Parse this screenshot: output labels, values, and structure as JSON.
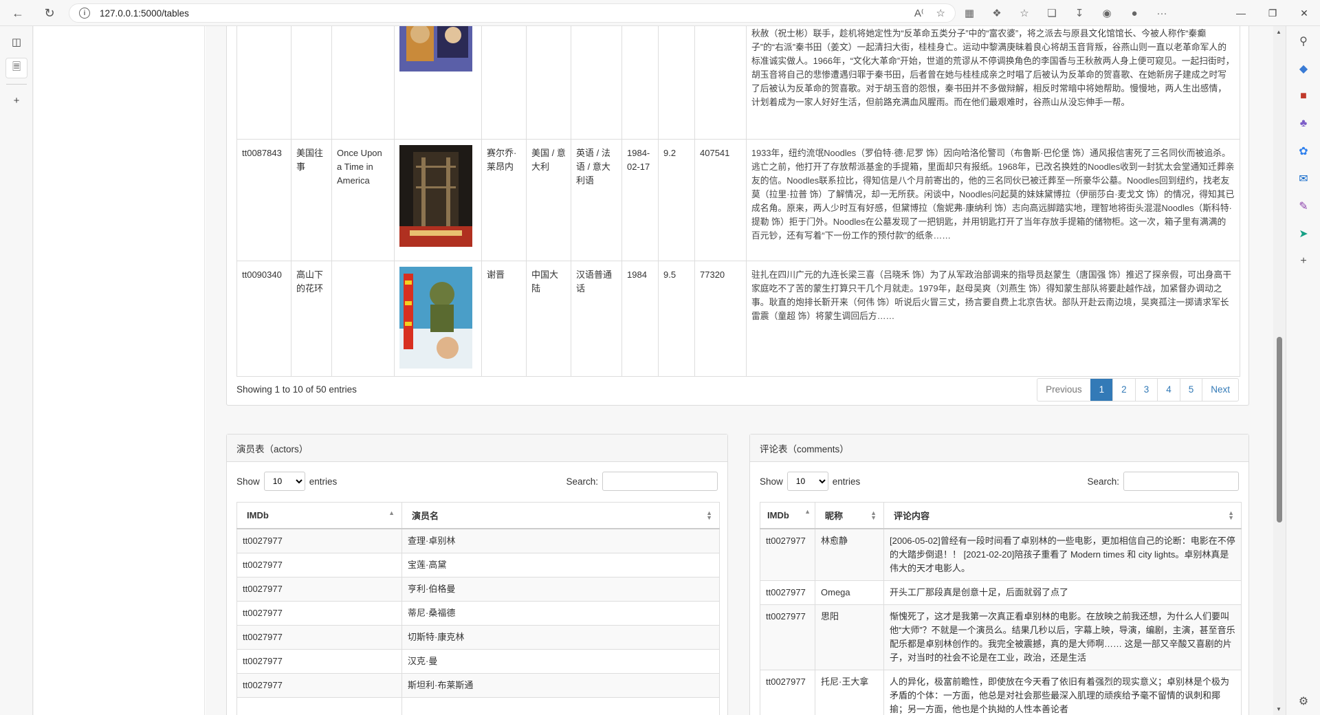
{
  "browser": {
    "url": "127.0.0.1:5000/tables"
  },
  "movies": {
    "rows": [
      {
        "id": "",
        "title": "",
        "title_en": "",
        "director": "",
        "country": "",
        "language": "",
        "date": "",
        "rating": "",
        "votes": "",
        "summary": "备日子更上一层楼时，迎上“四清运动”，一直嫉妒胡玉音的原国营饮食店经理、今县商业局科长李国香（徐松子）与二流子王秋赦（祝士彬）联手，趁机将她定性为“反革命五类分子”中的“富农婆”，将之派去与原县文化馆馆长、今被人称作“秦癫子”的“右派”秦书田（姜文）一起清扫大街，桂桂身亡。运动中黎满庚昧着良心将胡玉音背叛，谷燕山则一直以老革命军人的标准诚实做人。1966年，“文化大革命”开始，世道的荒谬从不停调换角色的李国香与王秋赦两人身上便可窥见。一起扫街时，胡玉音将自己的悲惨遭遇归罪于秦书田，后者曾在她与桂桂成亲之时唱了后被认为反革命的贺喜歌、在她新房子建成之时写了后被认为反革命的贺喜歌。对于胡玉音的怨恨，秦书田并不多做辩解，相反时常暗中将她帮助。慢慢地，两人生出感情，计划着成为一家人好好生活，但前路充满血风腥雨。而在他们最艰难时，谷燕山从没忘伸手一帮。"
      },
      {
        "id": "tt0087843",
        "title": "美国往事",
        "title_en": "Once Upon a Time in America",
        "director": "赛尔乔·莱昂内",
        "country": "美国 / 意大利",
        "language": "英语 / 法语 / 意大利语",
        "date": "1984-02-17",
        "rating": "9.2",
        "votes": "407541",
        "summary": "1933年，纽约流氓Noodles（罗伯特·德·尼罗 饰）因向哈洛伦警司（布鲁斯·巴伦堡 饰）通风报信害死了三名同伙而被追杀。逃亡之前，他打开了存放帮派基金的手提箱，里面却只有报纸。1968年，已改名换姓的Noodles收到一封犹太会堂通知迁葬亲友的信。Noodles联系拉比，得知信是八个月前寄出的，他的三名同伙已被迁葬至一所豪华公墓。Noodles回到纽约，找老友莫（拉里·拉普 饰）了解情况，却一无所获。闲谈中，Noodles问起莫的妹妹黛博拉（伊丽莎白·麦戈文 饰）的情况，得知其已成名角。原来，两人少时互有好感，但黛博拉（詹妮弗·康纳利 饰）志向高远脚踏实地，理智地将街头混混Noodles（斯科特·提勒 饰）拒于门外。Noodles在公墓发现了一把钥匙，并用钥匙打开了当年存放手提箱的储物柜。这一次，箱子里有满满的百元钞，还有写着“下一份工作的预付款”的纸条……"
      },
      {
        "id": "tt0090340",
        "title": "高山下的花环",
        "title_en": "",
        "director": "谢晋",
        "country": "中国大陆",
        "language": "汉语普通话",
        "date": "1984",
        "rating": "9.5",
        "votes": "77320",
        "summary": "驻扎在四川广元的九连长梁三喜（吕晓禾 饰）为了从军政治部调来的指导员赵蒙生（唐国强 饰）推迟了探亲假，可出身高干家庭吃不了苦的蒙生打算只干几个月就走。1979年，赵母吴爽（刘燕生 饰）得知蒙生部队将要赴越作战，加紧督办调动之事。耿直的炮排长靳开来（何伟 饰）听说后火冒三丈，扬言要自费上北京告状。部队开赴云南边境，吴爽孤注一掷请求军长雷震（童超 饰）将蒙生调回后方……"
      }
    ],
    "info": "Showing 1 to 10 of 50 entries",
    "pagination": [
      "Previous",
      "1",
      "2",
      "3",
      "4",
      "5",
      "Next"
    ]
  },
  "actors": {
    "header": "演员表（actors）",
    "show_label": "Show",
    "entries_label": "entries",
    "length_value": "10",
    "search_label": "Search:",
    "columns": [
      "IMDb",
      "演员名"
    ],
    "rows": [
      [
        "tt0027977",
        "查理·卓别林"
      ],
      [
        "tt0027977",
        "宝莲·高黛"
      ],
      [
        "tt0027977",
        "亨利·伯格曼"
      ],
      [
        "tt0027977",
        "蒂尼·桑福德"
      ],
      [
        "tt0027977",
        "切斯特·康克林"
      ],
      [
        "tt0027977",
        "汉克·曼"
      ],
      [
        "tt0027977",
        "斯坦利·布莱斯通"
      ],
      [
        "",
        ""
      ]
    ]
  },
  "comments": {
    "header": "评论表（comments）",
    "show_label": "Show",
    "entries_label": "entries",
    "length_value": "10",
    "search_label": "Search:",
    "columns": [
      "IMDb",
      "昵称",
      "评论内容"
    ],
    "rows": [
      [
        "tt0027977",
        "林愈静",
        "[2006-05-02]曾经有一段时间看了卓别林的一些电影，更加相信自己的论断：电影在不停的大踏步倒退！！ [2021-02-20]陪孩子重看了 Modern times 和 city lights。卓别林真是伟大的天才电影人。"
      ],
      [
        "tt0027977",
        "Omega",
        "开头工厂那段真是创意十足，后面就弱了点了"
      ],
      [
        "tt0027977",
        "思阳",
        "惭愧死了，这才是我第一次真正看卓别林的电影。在放映之前我还想，为什么人们要叫他“大师”？不就是一个演员么。结果几秒以后，字幕上映，导演，编剧，主演，甚至音乐配乐都是卓别林创作的。我完全被震撼，真的是大师啊…… 这是一部又辛酸又喜剧的片子，对当时的社会不论是在工业，政治，还是生活"
      ],
      [
        "tt0027977",
        "托尼·王大拿",
        "人的异化，极富前瞻性，即使放在今天看了依旧有着强烈的现实意义；卓别林是个极为矛盾的个体：一方面，他总是对社会那些最深入肌理的顽疾给予毫不留情的讽刺和揶揄；另一方面，他也是个执拗的人性本善论者"
      ]
    ]
  },
  "colors": {
    "accent": "#337ab7"
  }
}
